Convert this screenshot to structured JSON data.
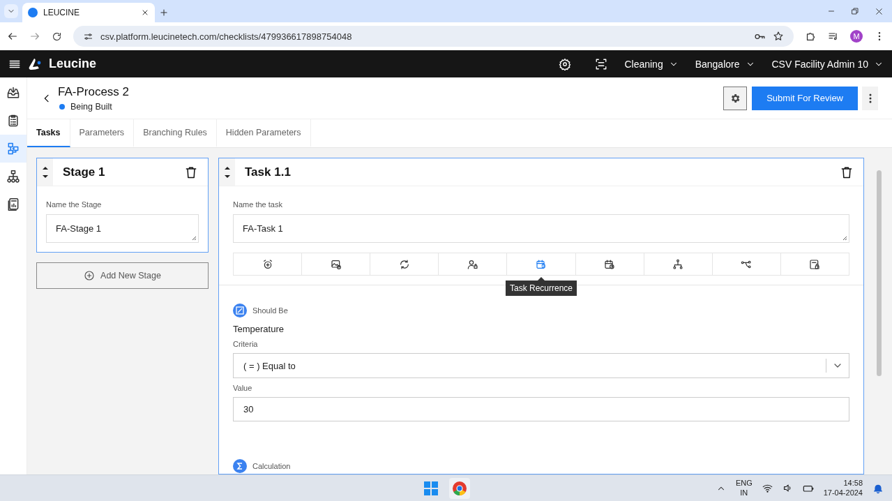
{
  "browser": {
    "tabs": [
      {
        "title": "LEUCINE",
        "selected": true
      }
    ],
    "url": "csv.platform.leucinetech.com/checklists/479936617898754048",
    "profile": "M"
  },
  "app_header": {
    "brand": "Leucine",
    "menus": [
      {
        "label": "Cleaning"
      },
      {
        "label": "Bangalore"
      },
      {
        "label": "CSV Facility Admin 10"
      }
    ]
  },
  "sidebar": {
    "items": [
      {
        "selected": false
      },
      {
        "selected": false
      },
      {
        "selected": true
      },
      {
        "selected": false
      },
      {
        "selected": false
      }
    ]
  },
  "page": {
    "title": "FA-Process 2",
    "status": "Being Built",
    "submit": "Submit For Review"
  },
  "tabs": [
    {
      "label": "Tasks",
      "selected": true
    },
    {
      "label": "Parameters",
      "selected": false
    },
    {
      "label": "Branching Rules",
      "selected": false
    },
    {
      "label": "Hidden Parameters",
      "selected": false
    }
  ],
  "stage": {
    "title": "Stage 1",
    "field_label": "Name the Stage",
    "value": "FA-Stage 1",
    "add_button": "Add New Stage"
  },
  "task": {
    "title": "Task 1.1",
    "field_label": "Name the task",
    "value": "FA-Task 1",
    "toolbar": [
      {
        "selected": false
      },
      {
        "selected": false
      },
      {
        "selected": false
      },
      {
        "selected": false
      },
      {
        "selected": true
      },
      {
        "selected": false
      },
      {
        "selected": false
      },
      {
        "selected": false
      },
      {
        "selected": false
      }
    ],
    "tooltip": "Task Recurrence",
    "parameters": [
      {
        "kind": "should_be",
        "type_label": "Should Be",
        "name": "Temperature",
        "criteria_label": "Criteria",
        "criteria": "( = ) Equal to",
        "value_label": "Value",
        "value": "30"
      },
      {
        "kind": "calculation",
        "type_label": "Calculation"
      }
    ]
  },
  "taskbar": {
    "language": "ENG",
    "region": "IN",
    "time": "14:58",
    "date": "17-04-2024"
  }
}
